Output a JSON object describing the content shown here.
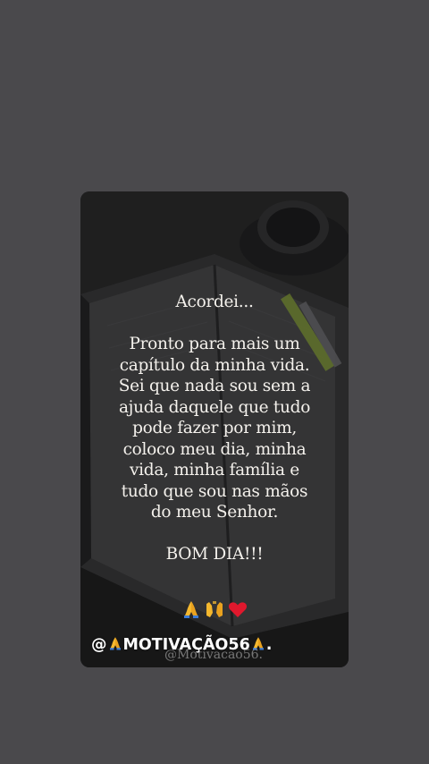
{
  "story": {
    "greeting": "Acordei...",
    "lines": [
      "Pronto para mais um",
      "capítulo da minha vida.",
      "Sei que nada sou sem a",
      "ajuda daquele que tudo",
      "pode fazer por mim,",
      "coloco meu dia, minha",
      "vida, minha família e",
      "tudo que sou nas mãos",
      "do meu Senhor."
    ],
    "closing": "BOM DIA!!!",
    "emojis": [
      "praying-hands-emoji",
      "raising-hands-emoji",
      "red-heart-emoji"
    ],
    "handle_prefix": "@",
    "handle_name": "MOTIVAÇÃO56",
    "handle_suffix": ".",
    "watermark": "@Motivacao56."
  },
  "colors": {
    "screen_background": "#4a494c",
    "card_background": "#2a2a2b",
    "text": "#f4f1ec",
    "heart": "#e0182d",
    "hands": "#f5b82e"
  }
}
